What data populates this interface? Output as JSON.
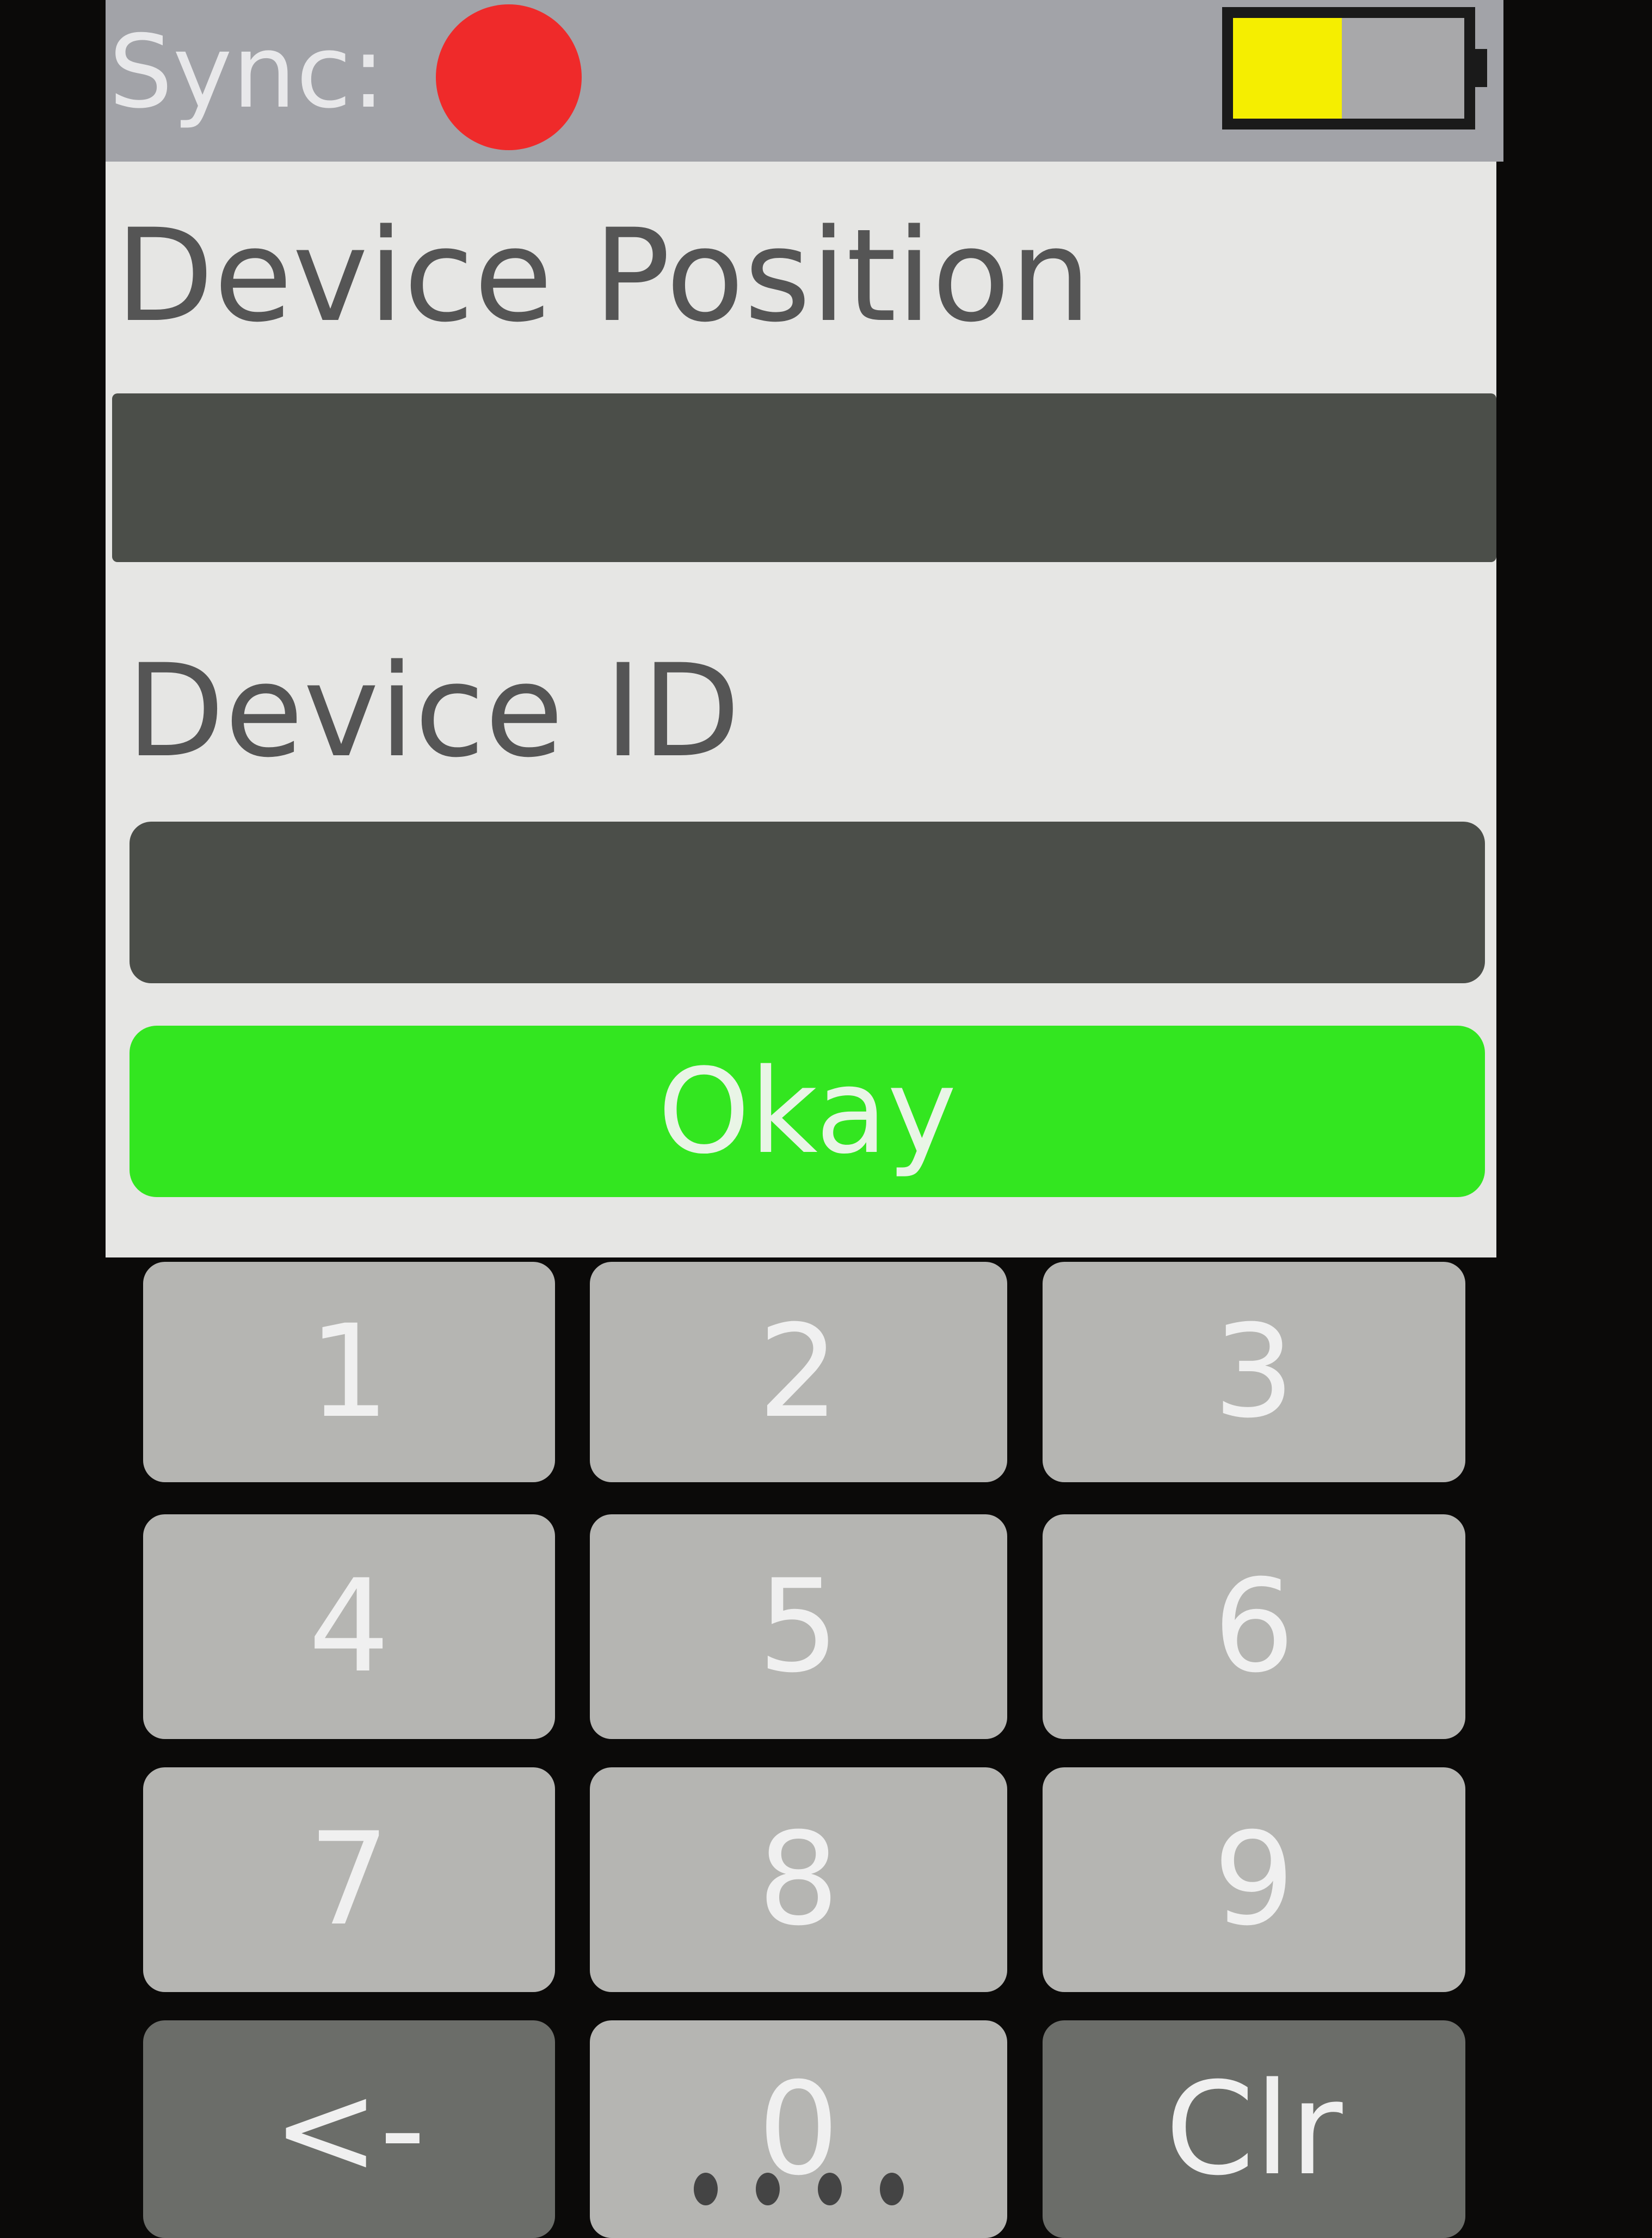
{
  "status_bar": {
    "sync_label": "Sync:",
    "sync_status_color": "#ef2a2a",
    "battery_level": 0.47,
    "battery_color": "#f5ee00"
  },
  "form": {
    "device_position_label": "Device Position",
    "device_position_value": "",
    "device_id_label": "Device ID",
    "device_id_value": "",
    "okay_label": "Okay",
    "okay_color": "#33e620"
  },
  "keypad": {
    "keys": [
      "1",
      "2",
      "3",
      "4",
      "5",
      "6",
      "7",
      "8",
      "9",
      "<-",
      "0",
      "Clr"
    ]
  }
}
